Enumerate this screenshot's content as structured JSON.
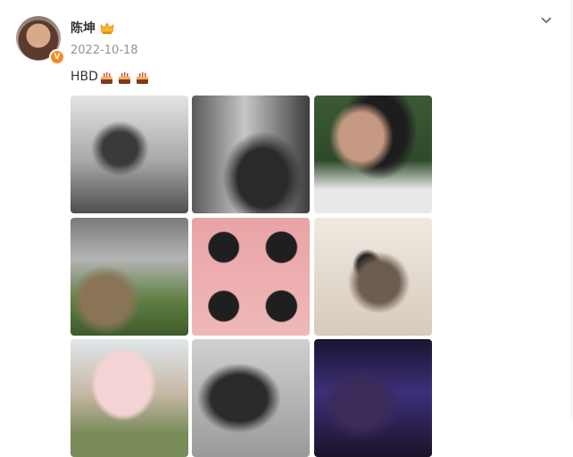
{
  "post": {
    "author": {
      "name": "陈坤",
      "verified_badge": "V",
      "badge_color": "#f78b1f"
    },
    "date": "2022-10-18",
    "text": "HBD",
    "emoji_icons": [
      "cake-icon",
      "cake-icon",
      "cake-icon"
    ],
    "photos": [
      {
        "name": "photo-1"
      },
      {
        "name": "photo-2"
      },
      {
        "name": "photo-3"
      },
      {
        "name": "photo-4"
      },
      {
        "name": "photo-5"
      },
      {
        "name": "photo-6"
      },
      {
        "name": "photo-7"
      },
      {
        "name": "photo-8"
      },
      {
        "name": "photo-9"
      }
    ],
    "menu_icon": "chevron-down-icon"
  }
}
